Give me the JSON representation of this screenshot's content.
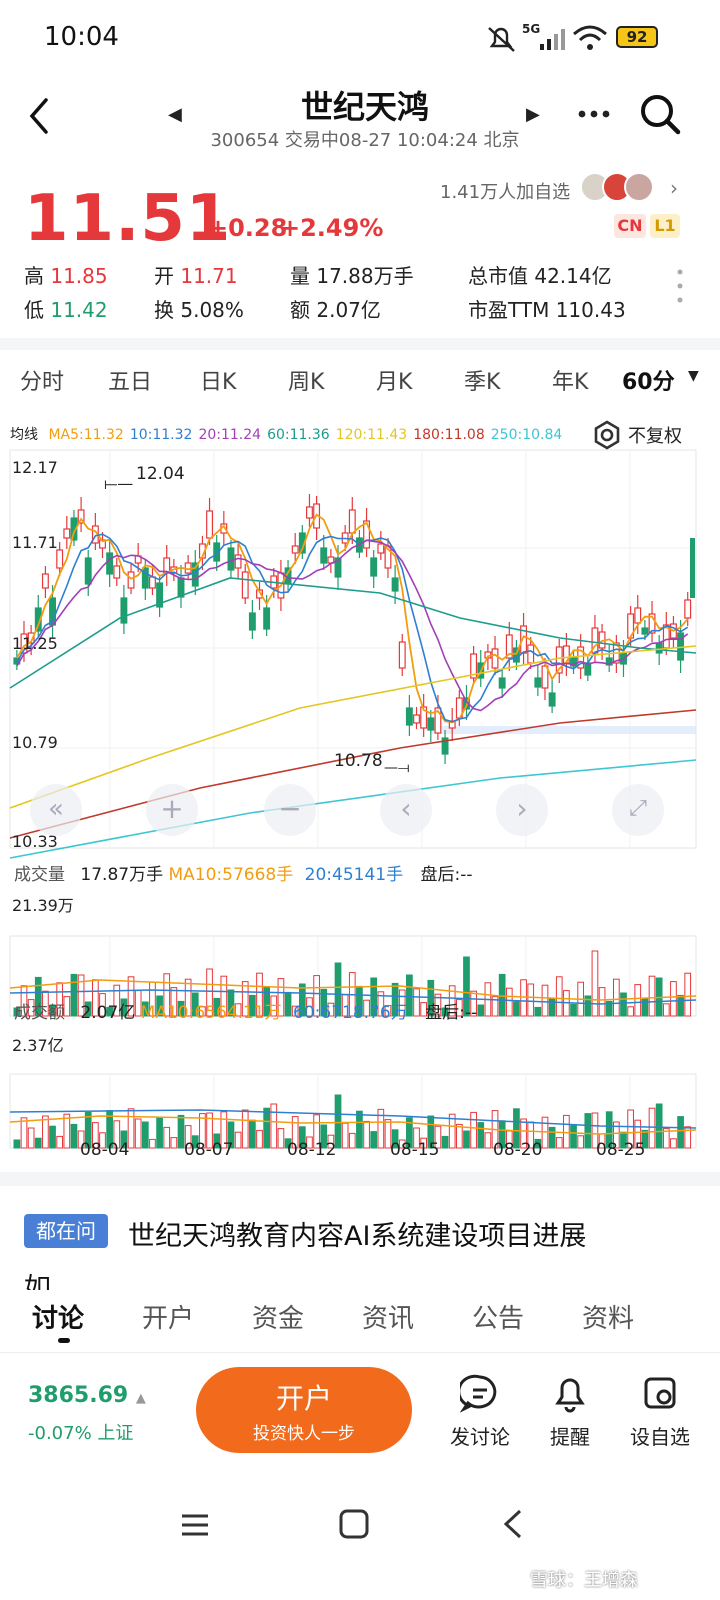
{
  "status": {
    "time": "10:04",
    "network": "5G",
    "battery": "92"
  },
  "header": {
    "title": "世纪天鸿",
    "code_status": "300654 交易中08-27 10:04:24 北京"
  },
  "quote": {
    "price": "11.51",
    "change": "+0.28",
    "change_pct": "+2.49%",
    "followers": "1.41万人加自选",
    "badge_cn": "CN",
    "badge_l1": "L1",
    "stats": [
      {
        "label": "高",
        "value": "11.85"
      },
      {
        "label": "开",
        "value": "11.71"
      },
      {
        "label": "量",
        "value": "17.88万手"
      },
      {
        "label": "总市值",
        "value": "42.14亿"
      },
      {
        "label": "低",
        "value": "11.42"
      },
      {
        "label": "换",
        "value": "5.08%"
      },
      {
        "label": "额",
        "value": "2.07亿"
      },
      {
        "label": "市盈TTM",
        "value": "110.43"
      }
    ]
  },
  "period_tabs": [
    "分时",
    "五日",
    "日K",
    "周K",
    "月K",
    "季K",
    "年K",
    "60分"
  ],
  "ma_legend": {
    "title": "均线",
    "items": [
      {
        "text": "MA5:11.32",
        "color": "#f29d11"
      },
      {
        "text": "10:11.32",
        "color": "#2f7fd1"
      },
      {
        "text": "20:11.24",
        "color": "#a23fb8"
      },
      {
        "text": "60:11.36",
        "color": "#1c9c8c"
      },
      {
        "text": "120:11.43",
        "color": "#e4c620"
      },
      {
        "text": "180:11.08",
        "color": "#c0392b"
      },
      {
        "text": "250:10.84",
        "color": "#3cc7d3"
      }
    ],
    "adjust": "不复权"
  },
  "kline": {
    "y_labels": [
      "12.17",
      "11.71",
      "11.25",
      "10.79",
      "10.33"
    ],
    "high_marker": "12.04",
    "low_marker": "10.78"
  },
  "volume": {
    "title": "成交量",
    "value": "17.87万手",
    "ma10": "MA10:57668手",
    "ma20": "20:45141手",
    "after": "盘后:--",
    "y_max": "21.39万"
  },
  "amount": {
    "title": "成交额",
    "value": "2.07亿",
    "ma10": "MA10:6564.11万",
    "ma60": "60:6718.76万",
    "after": "盘后:--",
    "y_max": "2.37亿"
  },
  "x_dates": [
    "08-04",
    "08-07",
    "08-12",
    "08-15",
    "08-20",
    "08-25"
  ],
  "news": {
    "tag": "都在问",
    "text": "世纪天鸿教育内容AI系统建设项目进展",
    "overflow": "如"
  },
  "bottom_tabs": [
    "讨论",
    "开户",
    "资金",
    "资讯",
    "公告",
    "资料"
  ],
  "index": {
    "value": "3865.69",
    "change": "-0.07%",
    "name": "上证"
  },
  "open_account": {
    "title": "开户",
    "subtitle": "投资快人一步"
  },
  "actions": [
    {
      "label": "发讨论"
    },
    {
      "label": "提醒"
    },
    {
      "label": "设自选"
    }
  ],
  "watermark": "雪球：王增森"
}
